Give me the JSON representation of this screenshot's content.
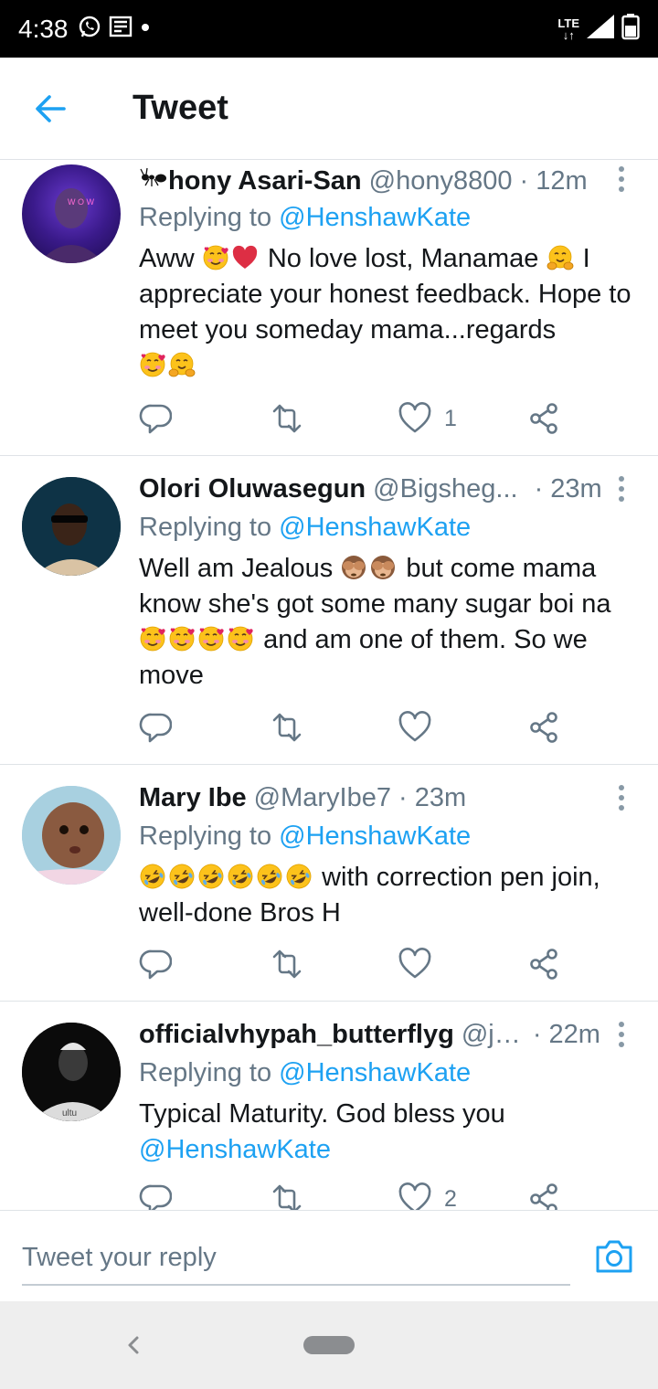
{
  "status_bar": {
    "time": "4:38",
    "network": "LTE"
  },
  "header": {
    "title": "Tweet"
  },
  "tweets": [
    {
      "name": "hony Asari-San",
      "handle": "@hony8800",
      "time": "· 12m",
      "replying_label": "Replying to",
      "replying_to": "@HenshawKate",
      "text_a": "Aww",
      "text_b": "No love lost, Manamae",
      "text_c": "I appreciate your honest feedback. Hope to meet you someday mama...regards",
      "likes": "1"
    },
    {
      "name": "Olori Oluwasegun",
      "handle": "@Bigsheg...",
      "time": "· 23m",
      "replying_label": "Replying to",
      "replying_to": "@HenshawKate",
      "text_a": "Well am Jealous",
      "text_b": "but come mama know she's got some many sugar boi na",
      "text_c": "and am one of them. So we move"
    },
    {
      "name": "Mary Ibe",
      "handle": "@MaryIbe7",
      "time": "· 23m",
      "replying_label": "Replying to",
      "replying_to": "@HenshawKate",
      "text_a": "with correction pen join, well-done Bros H"
    },
    {
      "name": "officialvhypah_butterflyg",
      "handle": "@jh...",
      "time": "· 22m",
      "replying_label": "Replying to",
      "replying_to": "@HenshawKate",
      "text_a": "Typical Maturity.  God bless you",
      "mention": "@HenshawKate",
      "likes": "2"
    }
  ],
  "reply_bar": {
    "placeholder": "Tweet your reply"
  },
  "colors": {
    "accent": "#1da1f2",
    "secondary_text": "#657786",
    "heart_red": "#e0245e"
  },
  "icons": [
    "whatsapp-icon",
    "news-icon",
    "signal-icon",
    "battery-icon",
    "back-arrow-icon",
    "more-vertical-icon",
    "reply-icon",
    "retweet-icon",
    "like-icon",
    "share-icon",
    "camera-icon",
    "ant-icon",
    "smiling-face-with-hearts-icon",
    "red-heart-icon",
    "hugging-face-icon",
    "see-no-evil-monkey-icon",
    "rolling-on-floor-laughing-icon"
  ]
}
